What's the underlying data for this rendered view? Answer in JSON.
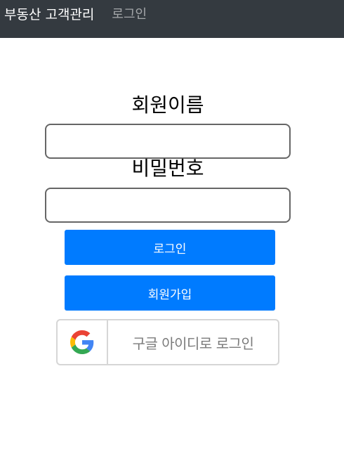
{
  "navbar": {
    "brand": "부동산 고객관리",
    "login_link": "로그인"
  },
  "form": {
    "name_label": "회원이름",
    "password_label": "비밀번호",
    "name_value": "",
    "password_value": "",
    "login_button": "로그인",
    "signup_button": "회원가입",
    "google_button": "구글 아이디로 로그인"
  },
  "colors": {
    "navbar_bg": "#343a40",
    "primary": "#007bff"
  },
  "icons": {
    "google": "google-logo-icon"
  }
}
